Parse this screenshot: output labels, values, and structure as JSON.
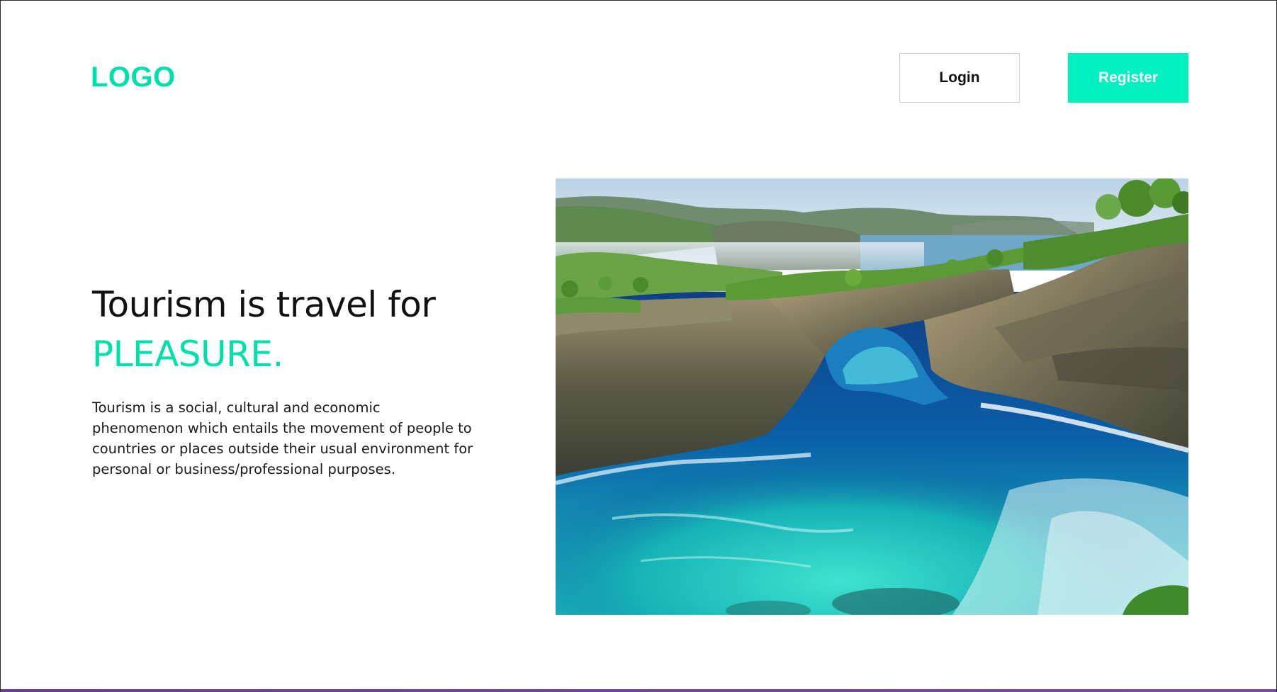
{
  "header": {
    "logo_text": "LOGO",
    "login_label": "Login",
    "register_label": "Register"
  },
  "hero": {
    "headline": "Tourism is travel for",
    "headline_accent": "PLEASURE.",
    "description": "Tourism is a social, cultural and economic phenomenon which entails the movement of people to countries or places outside their usual environment for personal or business/professional purposes."
  },
  "colors": {
    "accent": "#00e0a8",
    "register_bg": "#00f0c0",
    "bottom_bar": "#6a3f93"
  },
  "image": {
    "subject": "sea-arch-cliff-photo"
  }
}
